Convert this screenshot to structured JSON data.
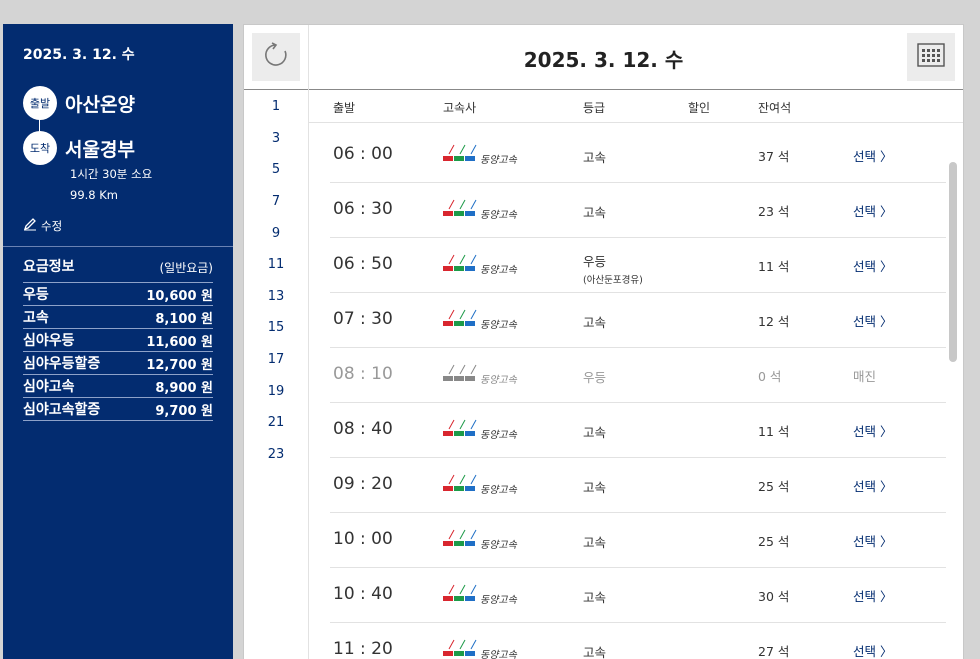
{
  "summary": {
    "date": "2025. 3. 12. 수",
    "departure_tag": "출발",
    "departure": "아산온양",
    "arrival_tag": "도착",
    "arrival": "서울경부",
    "duration": "1시간 30분 소요",
    "distance": "99.8 Km",
    "edit_label": "수정"
  },
  "fare": {
    "title": "요금정보",
    "subtitle": "(일반요금)",
    "items": [
      {
        "name": "우등",
        "price": "10,600 원"
      },
      {
        "name": "고속",
        "price": "8,100 원"
      },
      {
        "name": "심야우등",
        "price": "11,600 원"
      },
      {
        "name": "심야우등할증",
        "price": "12,700 원"
      },
      {
        "name": "심야고속",
        "price": "8,900 원"
      },
      {
        "name": "심야고속할증",
        "price": "9,700 원"
      }
    ]
  },
  "header": {
    "title": "2025. 3. 12. 수",
    "refresh_icon": "refresh-icon",
    "calendar_icon": "calendar-icon"
  },
  "hours": [
    "1",
    "3",
    "5",
    "7",
    "9",
    "11",
    "13",
    "15",
    "17",
    "19",
    "21",
    "23"
  ],
  "columns": {
    "depart": "출발",
    "company": "고속사",
    "grade": "등급",
    "discount": "할인",
    "seats": "잔여석"
  },
  "company_name": "동양고속",
  "colors": {
    "navy": "#032c70",
    "logo_red": "#d8262e",
    "logo_green": "#1d9a48",
    "logo_blue": "#1f6fc6"
  },
  "schedules": [
    {
      "time": "06 : 00",
      "grade": "고속",
      "sub": "",
      "seats": "37 석",
      "action": "선택 〉",
      "available": true
    },
    {
      "time": "06 : 30",
      "grade": "고속",
      "sub": "",
      "seats": "23 석",
      "action": "선택 〉",
      "available": true
    },
    {
      "time": "06 : 50",
      "grade": "우등",
      "sub": "(아산둔포경유)",
      "seats": "11 석",
      "action": "선택 〉",
      "available": true
    },
    {
      "time": "07 : 30",
      "grade": "고속",
      "sub": "",
      "seats": "12 석",
      "action": "선택 〉",
      "available": true
    },
    {
      "time": "08 : 10",
      "grade": "우등",
      "sub": "",
      "seats": "0 석",
      "action": "매진",
      "available": false
    },
    {
      "time": "08 : 40",
      "grade": "고속",
      "sub": "",
      "seats": "11 석",
      "action": "선택 〉",
      "available": true
    },
    {
      "time": "09 : 20",
      "grade": "고속",
      "sub": "",
      "seats": "25 석",
      "action": "선택 〉",
      "available": true
    },
    {
      "time": "10 : 00",
      "grade": "고속",
      "sub": "",
      "seats": "25 석",
      "action": "선택 〉",
      "available": true
    },
    {
      "time": "10 : 40",
      "grade": "고속",
      "sub": "",
      "seats": "30 석",
      "action": "선택 〉",
      "available": true
    },
    {
      "time": "11 : 20",
      "grade": "고속",
      "sub": "",
      "seats": "27 석",
      "action": "선택 〉",
      "available": true
    }
  ]
}
